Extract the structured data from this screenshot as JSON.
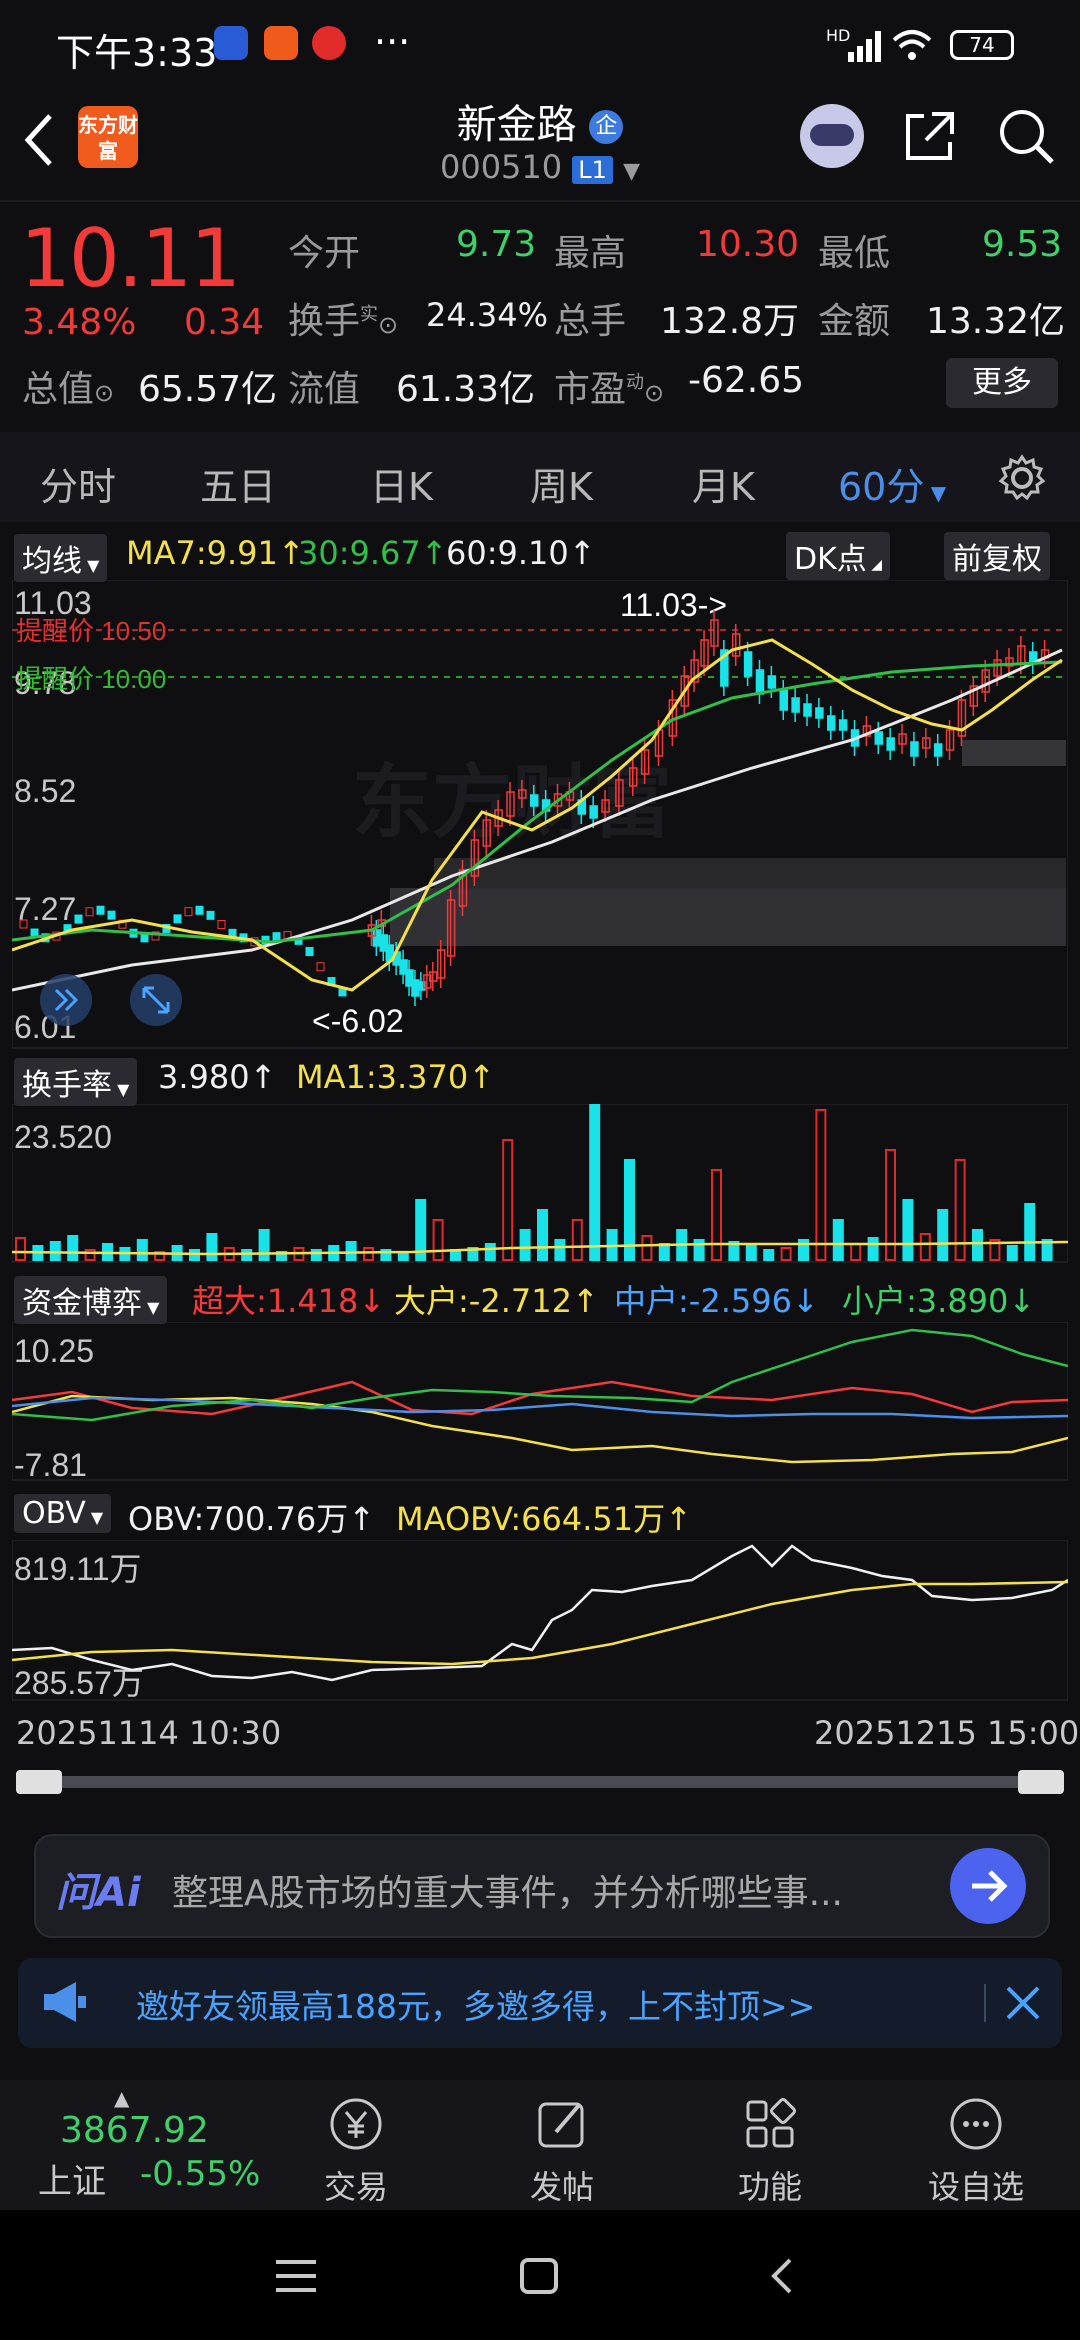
{
  "status_bar": {
    "time": "下午3:33",
    "battery": "74",
    "network": "HD"
  },
  "header": {
    "title": "新金路",
    "enterprise_badge": "企",
    "code": "000510",
    "market_tag": "L1",
    "logo_text": "东方财富"
  },
  "quote": {
    "price": "10.11",
    "change_pct": "3.48%",
    "change": "0.34",
    "open_label": "今开",
    "open": "9.73",
    "high_label": "最高",
    "high": "10.30",
    "low_label": "最低",
    "low": "9.53",
    "turnover_label": "换手",
    "turnover_sup": "实",
    "turnover": "24.34%",
    "volume_label": "总手",
    "volume": "132.8万",
    "amount_label": "金额",
    "amount": "13.32亿",
    "mktcap_label": "总值",
    "mktcap": "65.57亿",
    "float_label": "流值",
    "float": "61.33亿",
    "pe_label": "市盈",
    "pe_sup": "动",
    "pe": "-62.65",
    "more_label": "更多"
  },
  "tabs": [
    "分时",
    "五日",
    "日K",
    "周K",
    "月K",
    "60分"
  ],
  "main_chart": {
    "indicator_label": "均线",
    "ma7": "MA7:9.91↑",
    "ma30": "30:9.67↑",
    "ma60": "60:9.10↑",
    "dk_label": "DK点",
    "adjust_label": "前复权",
    "y_labels": [
      "11.03",
      "9.78",
      "8.52",
      "7.27",
      "6.01"
    ],
    "alert1": "提醒价 10.50",
    "alert2": "提醒价 10.00",
    "high_marker": "11.03->",
    "low_marker": "<-6.02",
    "watermark": "东方财富"
  },
  "turnover_panel": {
    "label": "换手率",
    "value": "3.980↑",
    "ma": "MA1:3.370↑",
    "y_top": "23.520"
  },
  "fund_panel": {
    "label": "资金博弈",
    "super": "超大:1.418↓",
    "big": "大户:-2.712↑",
    "mid": "中户:-2.596↓",
    "small": "小户:3.890↓",
    "y_top": "10.25",
    "y_bottom": "-7.81"
  },
  "obv_panel": {
    "label": "OBV",
    "obv": "OBV:700.76万↑",
    "maobv": "MAOBV:664.51万↑",
    "y_top": "819.11万",
    "y_bottom": "285.57万"
  },
  "time_axis": {
    "start": "20251114 10:30",
    "end": "20251215 15:00"
  },
  "ai_box": {
    "logo": "问Ai",
    "prompt": "整理A股市场的重大事件，并分析哪些事..."
  },
  "banner": {
    "text": "邀好友领最高188元，多邀多得，上不封顶>>"
  },
  "bottom_nav": {
    "index_value": "3867.92",
    "index_name": "上证",
    "index_change": "-0.55%",
    "trade": "交易",
    "post": "发帖",
    "function": "功能",
    "watch": "设自选"
  },
  "colors": {
    "up": "#f23a3a",
    "down": "#3ed06a",
    "ma7": "#f5e04a",
    "ma30": "#2fbf4a",
    "ma60": "#e8e8e8",
    "bar_up": "#e02a2a",
    "bar_down": "#19e3e8",
    "accent": "#4aa3ff"
  }
}
